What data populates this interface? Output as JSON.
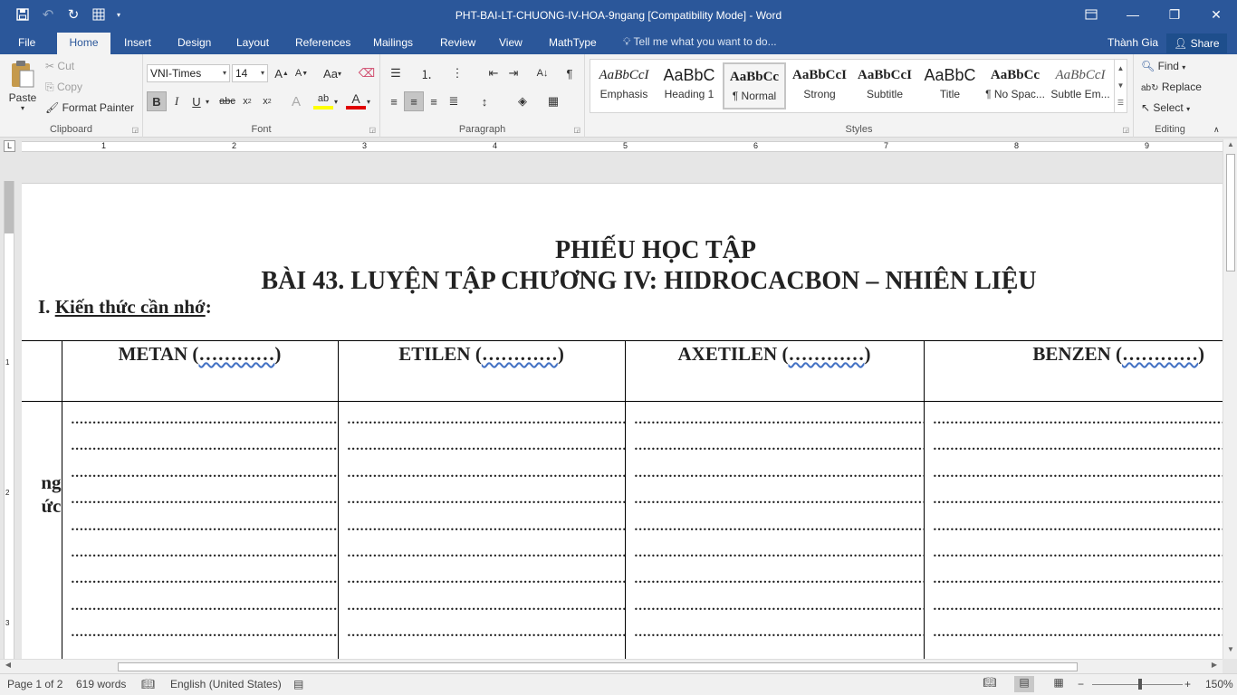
{
  "titlebar": {
    "doc_title": "PHT-BAI-LT-CHUONG-IV-HOA-9ngang [Compatibility Mode] - Word",
    "qat": [
      "save-icon",
      "undo-icon",
      "redo-icon",
      "table-icon",
      "customize-icon"
    ],
    "window_buttons": [
      "ribbon-display-icon",
      "minimize-icon",
      "restore-icon",
      "close-icon"
    ]
  },
  "tabs": {
    "file": "File",
    "home": "Home",
    "insert": "Insert",
    "design": "Design",
    "layout": "Layout",
    "references": "References",
    "mailings": "Mailings",
    "review": "Review",
    "view": "View",
    "mathtype": "MathType",
    "tell_me": "Tell me what you want to do...",
    "user": "Thành Gia",
    "share": "Share"
  },
  "ribbon": {
    "clipboard": {
      "label": "Clipboard",
      "paste": "Paste",
      "cut": "Cut",
      "copy": "Copy",
      "format_painter": "Format Painter"
    },
    "font": {
      "label": "Font",
      "font_name": "VNI-Times",
      "font_size": "14",
      "change_case": "Aa"
    },
    "paragraph": {
      "label": "Paragraph"
    },
    "styles": {
      "label": "Styles",
      "items": [
        {
          "preview": "AaBbCcI",
          "name": "Emphasis"
        },
        {
          "preview": "AaBbC",
          "name": "Heading 1"
        },
        {
          "preview": "AaBbCc",
          "name": "¶ Normal"
        },
        {
          "preview": "AaBbCcI",
          "name": "Strong"
        },
        {
          "preview": "AaBbCcI",
          "name": "Subtitle"
        },
        {
          "preview": "AaBbC",
          "name": "Title"
        },
        {
          "preview": "AaBbCc",
          "name": "¶ No Spac..."
        },
        {
          "preview": "AaBbCcI",
          "name": "Subtle Em..."
        }
      ]
    },
    "editing": {
      "label": "Editing",
      "find": "Find",
      "replace": "Replace",
      "select": "Select"
    }
  },
  "ruler": {
    "numbers": [
      "1",
      "2",
      "3",
      "4",
      "5",
      "6",
      "7",
      "8",
      "9"
    ],
    "vertical_numbers": [
      "1",
      "2",
      "3"
    ]
  },
  "document": {
    "title1": "PHIẾU HỌC TẬP",
    "title2": "BÀI 43. LUYỆN TẬP CHƯƠNG IV: HIDROCACBON – NHIÊN LIỆU",
    "section_prefix": "I. ",
    "section_underlined": "Kiến thức cần nhớ",
    "section_suffix": ":",
    "side_label_line1": "ng",
    "side_label_line2": "ức",
    "columns": [
      {
        "name": "METAN",
        "paren_open": " (",
        "dots": "…………",
        "paren_close": ")"
      },
      {
        "name": "ETILEN",
        "paren_open": " (",
        "dots": "…………",
        "paren_close": ")"
      },
      {
        "name": "AXETILEN",
        "paren_open": " (",
        "dots": "…………",
        "paren_close": ")"
      },
      {
        "name": "BENZEN",
        "paren_open": " (",
        "dots": "…………",
        "paren_close": ")"
      }
    ],
    "dot_line": "...................................................................................................."
  },
  "statusbar": {
    "page": "Page 1 of 2",
    "words": "619 words",
    "language": "English (United States)",
    "zoom": "150%"
  }
}
